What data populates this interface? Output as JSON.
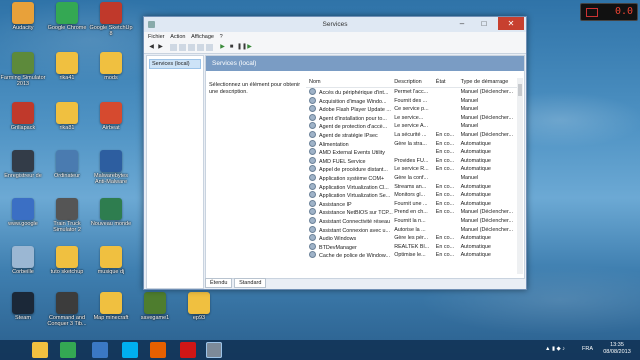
{
  "desktop": {
    "icons": [
      {
        "label": "Audacity",
        "color": "#e8a13a"
      },
      {
        "label": "Google Chrome",
        "color": "#34a853"
      },
      {
        "label": "Google SketchUp 8",
        "color": "#c0392b"
      },
      {
        "label": "Farming Simulator 2013",
        "color": "#5d8a3b"
      },
      {
        "label": "rika41",
        "color": "#f0c040"
      },
      {
        "label": "mods",
        "color": "#f0c040"
      },
      {
        "label": "Grillapack",
        "color": "#c0392b"
      },
      {
        "label": "rika81",
        "color": "#f0c040"
      },
      {
        "label": "Airbeat",
        "color": "#d64a2f"
      },
      {
        "label": "Enregistreur de",
        "color": "#333c48"
      },
      {
        "label": "Ordinateur",
        "color": "#4a7bb0"
      },
      {
        "label": "Malwarebytes Anti-Malware",
        "color": "#2d5ea0"
      },
      {
        "label": "www.google",
        "color": "#3b6fc4"
      },
      {
        "label": "Train Truck Simulator 2",
        "color": "#555"
      },
      {
        "label": "Nouveau monde",
        "color": "#2e7d4f"
      },
      {
        "label": "Corbeille",
        "color": "#9bb7d3"
      },
      {
        "label": "tuto sketchup",
        "color": "#f0c040"
      },
      {
        "label": "musique dj",
        "color": "#f0c040"
      },
      {
        "label": "Steam",
        "color": "#1b2838"
      },
      {
        "label": "Command and Conquer 3 Tib...",
        "color": "#3c3c3c"
      },
      {
        "label": "Map minecraft",
        "color": "#f0c040"
      },
      {
        "label": "savegame1",
        "color": "#4e7d2e"
      },
      {
        "label": "ep93",
        "color": "#f0c040"
      }
    ]
  },
  "clock_widget": {
    "display": "0.0"
  },
  "window": {
    "title": "Services",
    "menu": [
      "Fichier",
      "Action",
      "Affichage",
      "?"
    ],
    "tree_label": "Services (local)",
    "header": "Services (local)",
    "description": "Sélectionnez un élément pour obtenir une description.",
    "columns": [
      "Nom",
      "Description",
      "État",
      "Type de démarrage"
    ],
    "rows": [
      [
        "Accès du périphérique d'int...",
        "Permet l'acc...",
        "",
        "Manuel (Déclencher..."
      ],
      [
        "Acquisition d'image Windo...",
        "Fournit des ...",
        "",
        "Manuel"
      ],
      [
        "Adobe Flash Player Update ...",
        "Ce service p...",
        "",
        "Manuel"
      ],
      [
        "Agent d'installation pour to...",
        "Le service...",
        "",
        "Manuel (Déclencher..."
      ],
      [
        "Agent de protection d'accè...",
        "Le service A...",
        "",
        "Manuel"
      ],
      [
        "Agent de stratégie IPsec",
        "La sécurité ...",
        "En co...",
        "Manuel (Déclencher..."
      ],
      [
        "Alimentation",
        "Gère la stra...",
        "En co...",
        "Automatique"
      ],
      [
        "AMD External Events Utility",
        "",
        "En co...",
        "Automatique"
      ],
      [
        "AMD FUEL Service",
        "Provides FU...",
        "En co...",
        "Automatique"
      ],
      [
        "Appel de procédure distant...",
        "Le service R...",
        "En co...",
        "Automatique"
      ],
      [
        "Application système COM+",
        "Gère la conf...",
        "",
        "Manuel"
      ],
      [
        "Application Virtualization Cl...",
        "Streams an...",
        "En co...",
        "Automatique"
      ],
      [
        "Application Virtualization Se...",
        "Monitors gl...",
        "En co...",
        "Automatique"
      ],
      [
        "Assistance IP",
        "Fournit une ...",
        "En co...",
        "Automatique"
      ],
      [
        "Assistance NetBIOS sur TCP...",
        "Prend en ch...",
        "En co...",
        "Manuel (Déclencher..."
      ],
      [
        "Assistant Connectivité réseau",
        "Fournit la n...",
        "",
        "Manuel (Déclencher..."
      ],
      [
        "Assistant Connexion avec u...",
        "Autorise la ...",
        "",
        "Manuel (Déclencher..."
      ],
      [
        "Audio Windows",
        "Gère les pér...",
        "En co...",
        "Automatique"
      ],
      [
        "BTDevManager",
        "REALTEK Bl...",
        "En co...",
        "Automatique"
      ],
      [
        "Cache de police de Window...",
        "Optimise le...",
        "En co...",
        "Automatique"
      ]
    ],
    "tabs": [
      "Étendu",
      "Standard"
    ]
  },
  "taskbar": {
    "apps": [
      {
        "name": "file-explorer",
        "color": "#f0c040"
      },
      {
        "name": "chrome",
        "color": "#34a853"
      },
      {
        "name": "windows-live",
        "color": "#3b78c4"
      },
      {
        "name": "skype",
        "color": "#00aff0"
      },
      {
        "name": "firefox",
        "color": "#e66000"
      },
      {
        "name": "record",
        "color": "#d01616"
      },
      {
        "name": "services",
        "color": "#7d8a99"
      }
    ],
    "lang": "FRA",
    "time": "13:35",
    "date": "08/08/2013"
  }
}
